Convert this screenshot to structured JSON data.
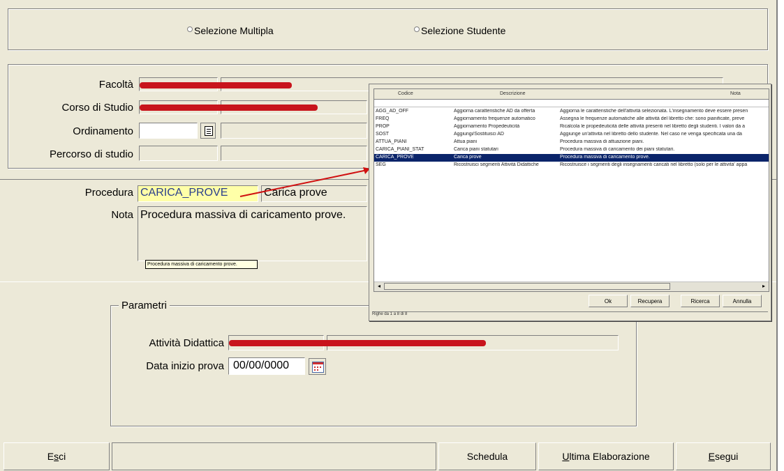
{
  "selection": {
    "multi": "Selezione Multipla",
    "student": "Selezione Studente"
  },
  "filters": {
    "facolta": "Facoltà",
    "corso": "Corso di Studio",
    "ordinamento": "Ordinamento",
    "percorso": "Percorso di studio"
  },
  "procedure": {
    "label": "Procedura",
    "code": "CARICA_PROVE",
    "desc": "Carica prove",
    "nota_label": "Nota",
    "nota": "Procedura massiva di caricamento prove.",
    "tooltip": "Procedura massiva di caricamento prove."
  },
  "params": {
    "title": "Parametri",
    "attivita_label": "Attività Didattica",
    "data_label": "Data inizio prova",
    "data_value": "00/00/0000"
  },
  "buttons": {
    "esci": "Esci",
    "schedula": "Schedula",
    "ultima": "Ultima Elaborazione",
    "esegui": "Esegui"
  },
  "popup": {
    "headers": {
      "codice": "Codice",
      "descrizione": "Descrizione",
      "nota": "Nota"
    },
    "rows": [
      {
        "codice": "AGG_AD_OFF",
        "descrizione": "Aggiorna caratteristiche AD da offerta",
        "nota": "Aggiorna le caratteristiche dell'attività selezionata. L'insegnamento deve essere presen"
      },
      {
        "codice": "FREQ",
        "descrizione": "Aggiornamento frequenze automatico",
        "nota": "Assegna le frequenze automatiche alle attività del libretto che: sono pianificate, preve"
      },
      {
        "codice": "PROP",
        "descrizione": "Aggiornamento Propedeuticità",
        "nota": "Ricalcola le propedeuticità delle attività presenti nel libretto degli studenti. I valori da a"
      },
      {
        "codice": "SOST",
        "descrizione": "Aggiungi/Sostituisci AD",
        "nota": "Aggiunge un'attività nel libretto dello studente. Nel caso ne venga specificata una da"
      },
      {
        "codice": "ATTUA_PIANI",
        "descrizione": "Attua piani",
        "nota": "Procedura massiva di attuazione piani."
      },
      {
        "codice": "CARICA_PIANI_STAT",
        "descrizione": "Carica piani statutari",
        "nota": "Procedura massiva di caricamento dei piani statutari."
      },
      {
        "codice": "CARICA_PROVE",
        "descrizione": "Carica prove",
        "nota": "Procedura massiva di caricamento prove."
      },
      {
        "codice": "SEG",
        "descrizione": "Ricostruisci segmenti Attività Didattiche",
        "nota": "Ricostruisce i segmenti degli insegnamenti caricati nel libretto (solo per le attivita' appa"
      }
    ],
    "selected_index": 6,
    "buttons": {
      "ok": "Ok",
      "recupera": "Recupera",
      "ricerca": "Ricerca",
      "annulla": "Annulla"
    },
    "status": "Righe da 1 a 8 di 8"
  },
  "colors": {
    "selection": "#0a246a",
    "redaction": "#c8141c",
    "procedure_field": "#ffffa8"
  }
}
